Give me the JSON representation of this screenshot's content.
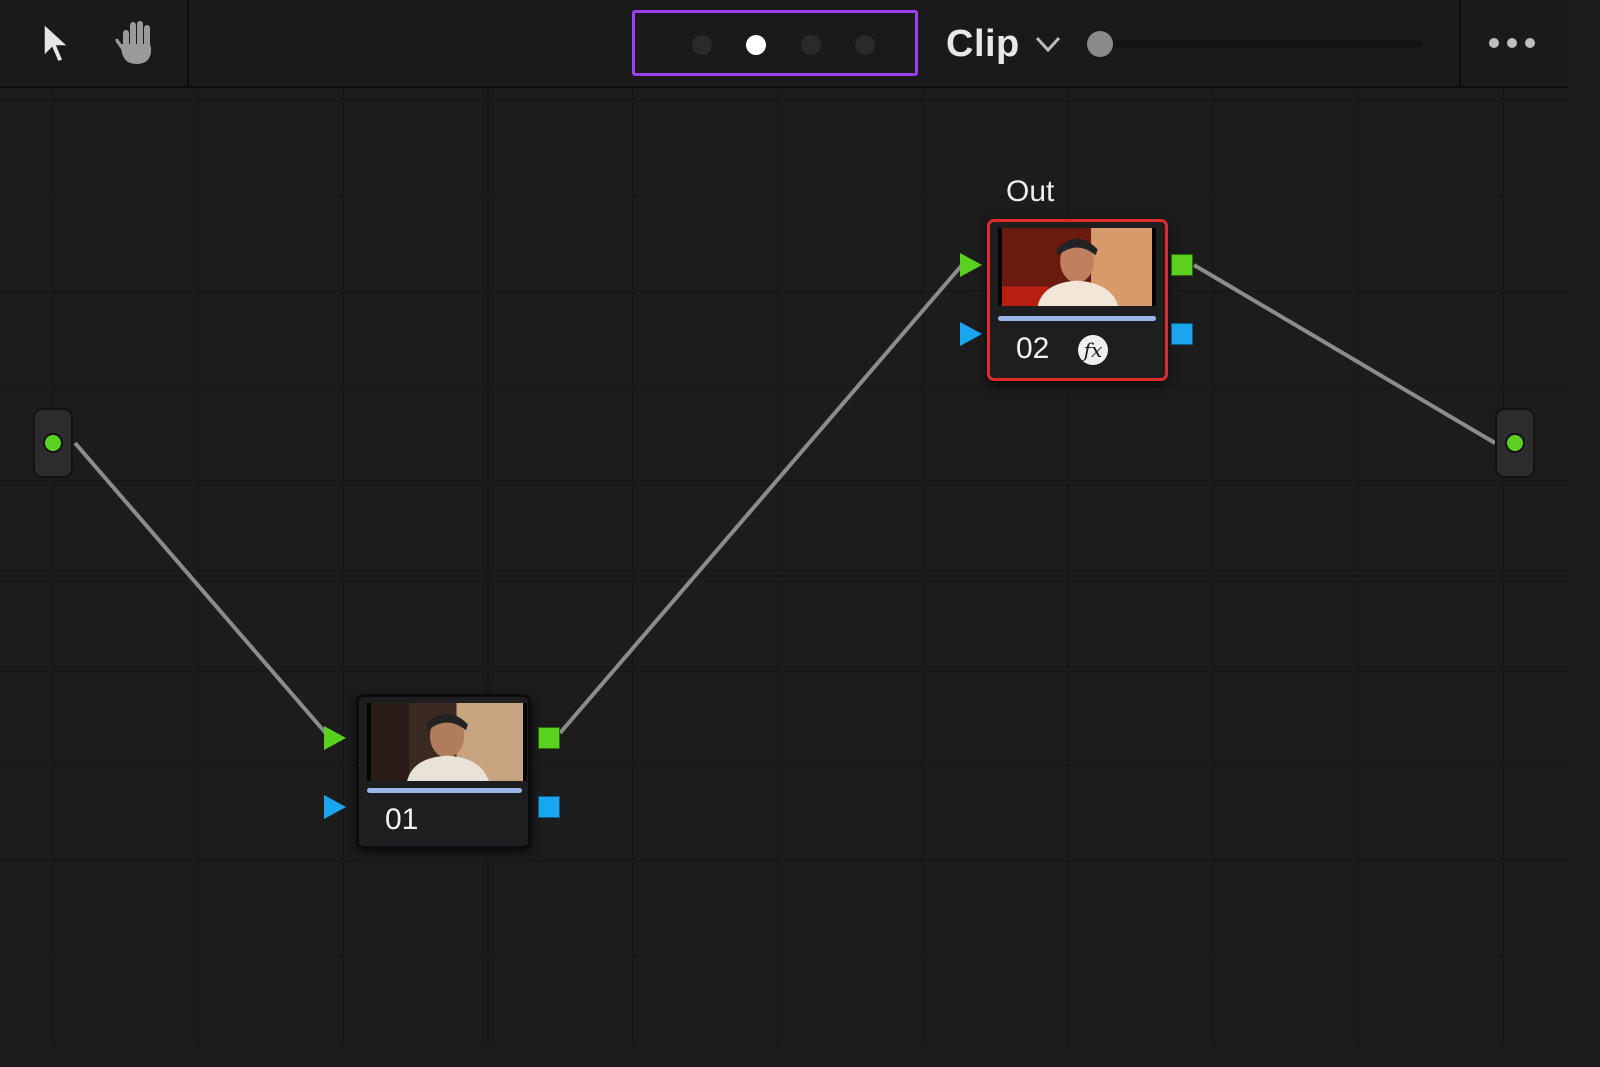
{
  "toolbar": {
    "tools": [
      {
        "icon": "pointer-arrow-icon",
        "selected": true
      },
      {
        "icon": "hand-pan-icon",
        "selected": false
      }
    ],
    "mode_dots": [
      {
        "active": false
      },
      {
        "active": true
      },
      {
        "active": false
      },
      {
        "active": false
      }
    ],
    "mode_label": "Clip",
    "mode_dropdown_icon": "chevron-down-icon",
    "more_icon": "more-horizontal-icon",
    "accent_color": "#9b3ff0"
  },
  "node_graph": {
    "input_icon": "input-connector-dot-icon",
    "output_icon": "output-connector-dot-icon",
    "nodes": [
      {
        "number": "01",
        "label": "",
        "selected": false,
        "has_fx": false
      },
      {
        "number": "02",
        "label": "Out",
        "selected": true,
        "has_fx": true,
        "fx_badge": "fx"
      }
    ],
    "colors": {
      "rgb_port": "#5ad11e",
      "alpha_port": "#1aa6ee",
      "selected_border": "#e02b2b",
      "link": "#8c8c8c"
    }
  }
}
